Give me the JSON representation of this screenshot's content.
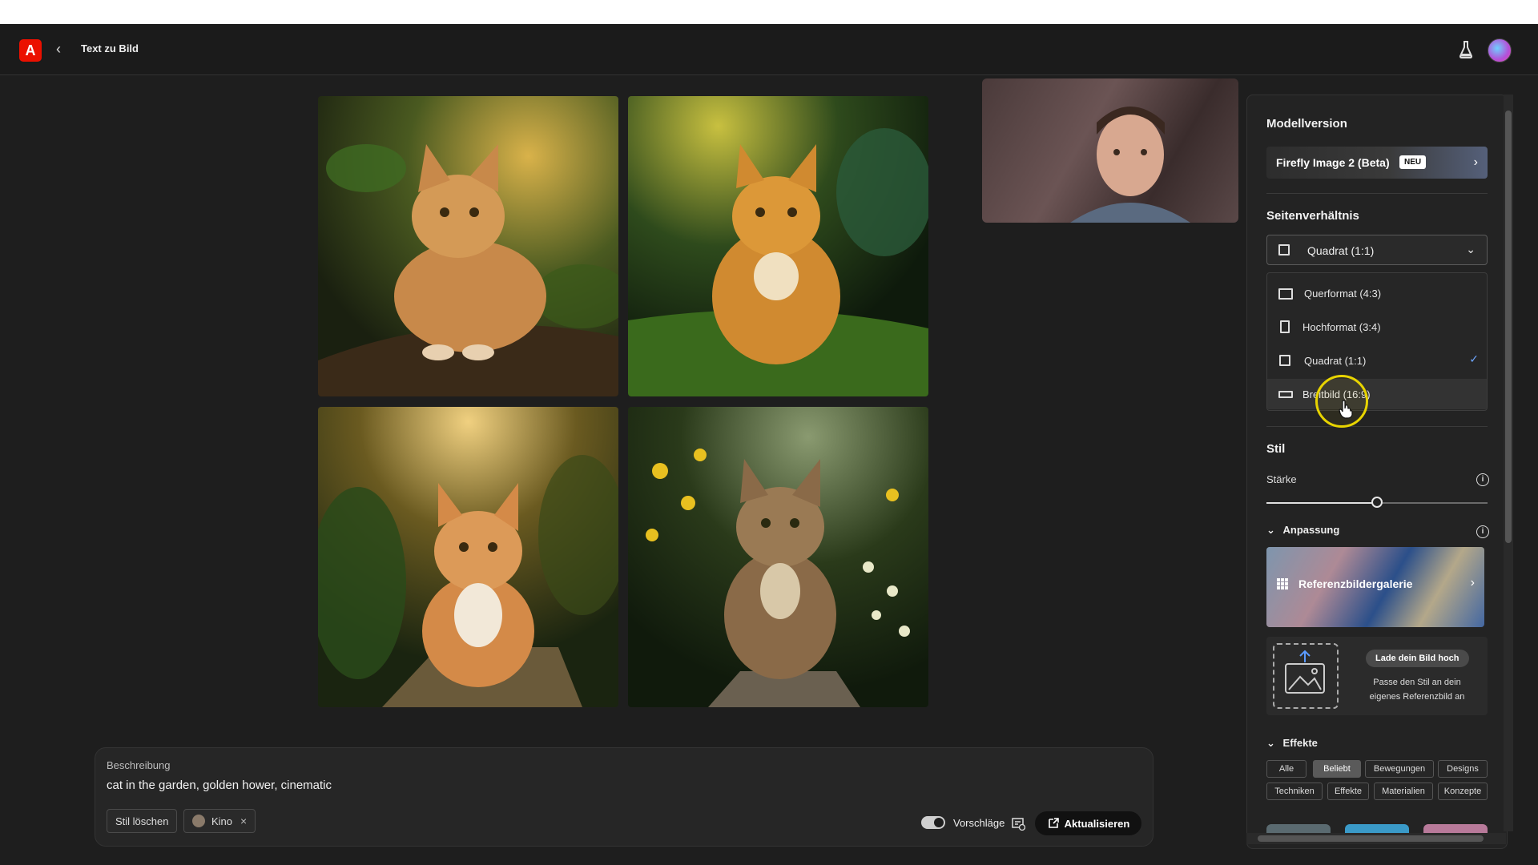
{
  "app": {
    "title": "Text zu Bild",
    "logo_letter": "A",
    "accent": "#eb1000"
  },
  "images": [
    {
      "name": "cat-image-1"
    },
    {
      "name": "cat-image-2"
    },
    {
      "name": "cat-image-3"
    },
    {
      "name": "cat-image-4"
    }
  ],
  "prompt": {
    "label": "Beschreibung",
    "text": "cat in the garden, golden hower, cinematic",
    "clear_style": "Stil löschen",
    "style_chip": "Kino",
    "chip_close": "×",
    "suggestions": "Vorschläge",
    "update": "Aktualisieren"
  },
  "panel": {
    "model_title": "Modellversion",
    "model_name": "Firefly Image 2 (Beta)",
    "model_badge": "NEU",
    "aspect_title": "Seitenverhältnis",
    "aspect_selected": "Quadrat (1:1)",
    "aspect_options": [
      {
        "label": "Querformat (4:3)"
      },
      {
        "label": "Hochformat (3:4)"
      },
      {
        "label": "Quadrat (1:1)",
        "selected": true
      },
      {
        "label": "Breitbild (16:9)",
        "hovered": true
      }
    ],
    "style_title": "Stil",
    "strength_label": "Stärke",
    "strength_value_percent": 50,
    "customize_title": "Anpassung",
    "gallery_label": "Referenzbildergalerie",
    "upload_button": "Lade dein Bild hoch",
    "upload_desc": "Passe den Stil an dein eigenes Referenzbild an",
    "effects_title": "Effekte",
    "effect_tags_row1": [
      "Alle",
      "Beliebt",
      "Bewegungen",
      "Designs"
    ],
    "effect_tags_row2": [
      "Techniken",
      "Effekte",
      "Materialien",
      "Konzepte"
    ],
    "active_tag": "Beliebt"
  }
}
